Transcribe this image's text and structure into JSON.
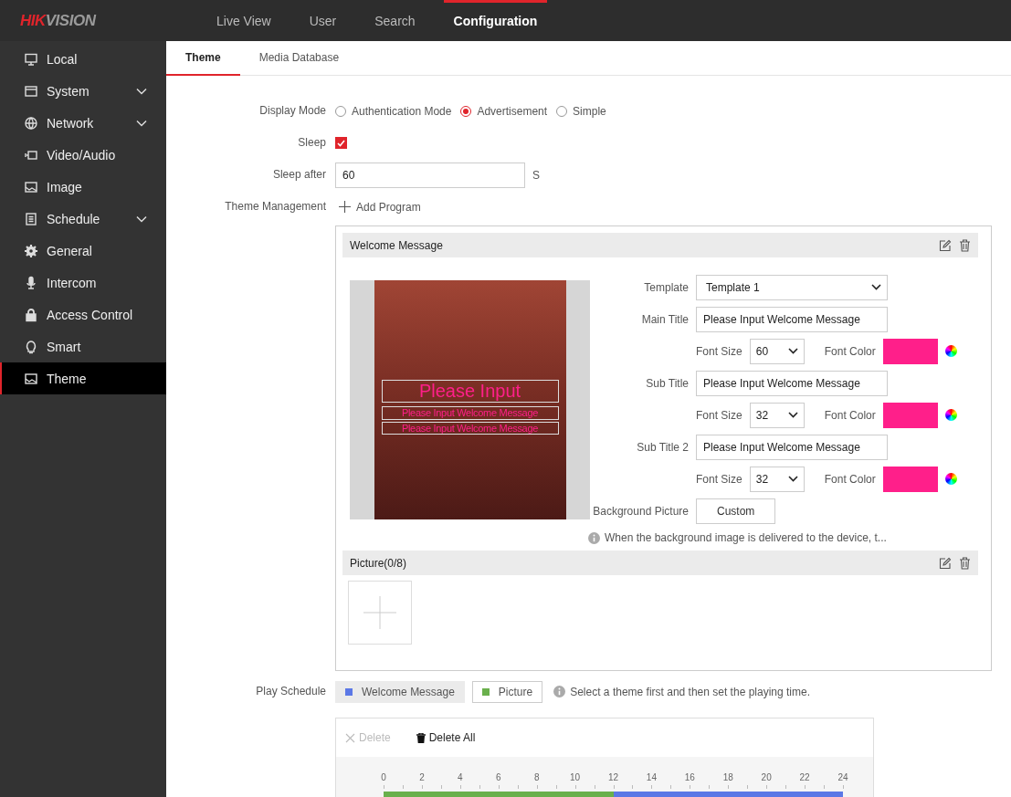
{
  "header": {
    "logo": {
      "accent": "HIK",
      "rest": "VISION"
    },
    "nav": [
      {
        "label": "Live View",
        "selected": false
      },
      {
        "label": "User",
        "selected": false
      },
      {
        "label": "Search",
        "selected": false
      },
      {
        "label": "Configuration",
        "selected": true
      }
    ]
  },
  "sidebar": {
    "items": [
      {
        "label": "Local",
        "expandable": false,
        "selected": false
      },
      {
        "label": "System",
        "expandable": true,
        "selected": false
      },
      {
        "label": "Network",
        "expandable": true,
        "selected": false
      },
      {
        "label": "Video/Audio",
        "expandable": false,
        "selected": false
      },
      {
        "label": "Image",
        "expandable": false,
        "selected": false
      },
      {
        "label": "Schedule",
        "expandable": true,
        "selected": false
      },
      {
        "label": "General",
        "expandable": false,
        "selected": false
      },
      {
        "label": "Intercom",
        "expandable": false,
        "selected": false
      },
      {
        "label": "Access Control",
        "expandable": false,
        "selected": false
      },
      {
        "label": "Smart",
        "expandable": false,
        "selected": false
      },
      {
        "label": "Theme",
        "expandable": false,
        "selected": true
      }
    ]
  },
  "tabs": [
    {
      "label": "Theme",
      "selected": true
    },
    {
      "label": "Media Database",
      "selected": false
    }
  ],
  "form": {
    "display_mode": {
      "label": "Display Mode",
      "options": [
        {
          "label": "Authentication Mode",
          "selected": false
        },
        {
          "label": "Advertisement",
          "selected": true
        },
        {
          "label": "Simple",
          "selected": false
        }
      ]
    },
    "sleep": {
      "label": "Sleep",
      "checked": true
    },
    "sleep_after": {
      "label": "Sleep after",
      "value": "60",
      "unit": "S"
    },
    "theme_management": {
      "label": "Theme Management",
      "add_button": "Add Program"
    }
  },
  "welcome_section": {
    "title": "Welcome Message",
    "preview_texts": [
      "Please Input",
      "Please Input Welcome Message",
      "Please Input Welcome Message"
    ],
    "template": {
      "label": "Template",
      "value": "Template 1"
    },
    "titles": [
      {
        "label": "Main Title",
        "value": "Please Input Welcome Message",
        "font_size_label": "Font Size",
        "font_size": "60",
        "font_color_label": "Font Color",
        "color": "#ff1f8a"
      },
      {
        "label": "Sub Title",
        "value": "Please Input Welcome Message",
        "font_size_label": "Font Size",
        "font_size": "32",
        "font_color_label": "Font Color",
        "color": "#ff1f8a"
      },
      {
        "label": "Sub Title 2",
        "value": "Please Input Welcome Message",
        "font_size_label": "Font Size",
        "font_size": "32",
        "font_color_label": "Font Color",
        "color": "#ff1f8a"
      }
    ],
    "background": {
      "label": "Background Picture",
      "button": "Custom"
    },
    "info": "When the background image is delivered to the device, t..."
  },
  "picture_section": {
    "title": "Picture(0/8)"
  },
  "play_schedule": {
    "label": "Play Schedule",
    "legend": [
      {
        "label": "Welcome Message",
        "color": "#5b78e6",
        "selected": true
      },
      {
        "label": "Picture",
        "color": "#6ab04c",
        "selected": false
      }
    ],
    "hint": "Select a theme first and then set the playing time.",
    "toolbar": [
      {
        "label": "Delete",
        "kind": "delete",
        "disabled": true
      },
      {
        "label": "Delete All",
        "kind": "delete_all",
        "disabled": false
      }
    ],
    "ticks": [
      "0",
      "2",
      "4",
      "6",
      "8",
      "10",
      "12",
      "14",
      "16",
      "18",
      "20",
      "22",
      "24"
    ],
    "timeline": {
      "level": 0.5
    }
  }
}
